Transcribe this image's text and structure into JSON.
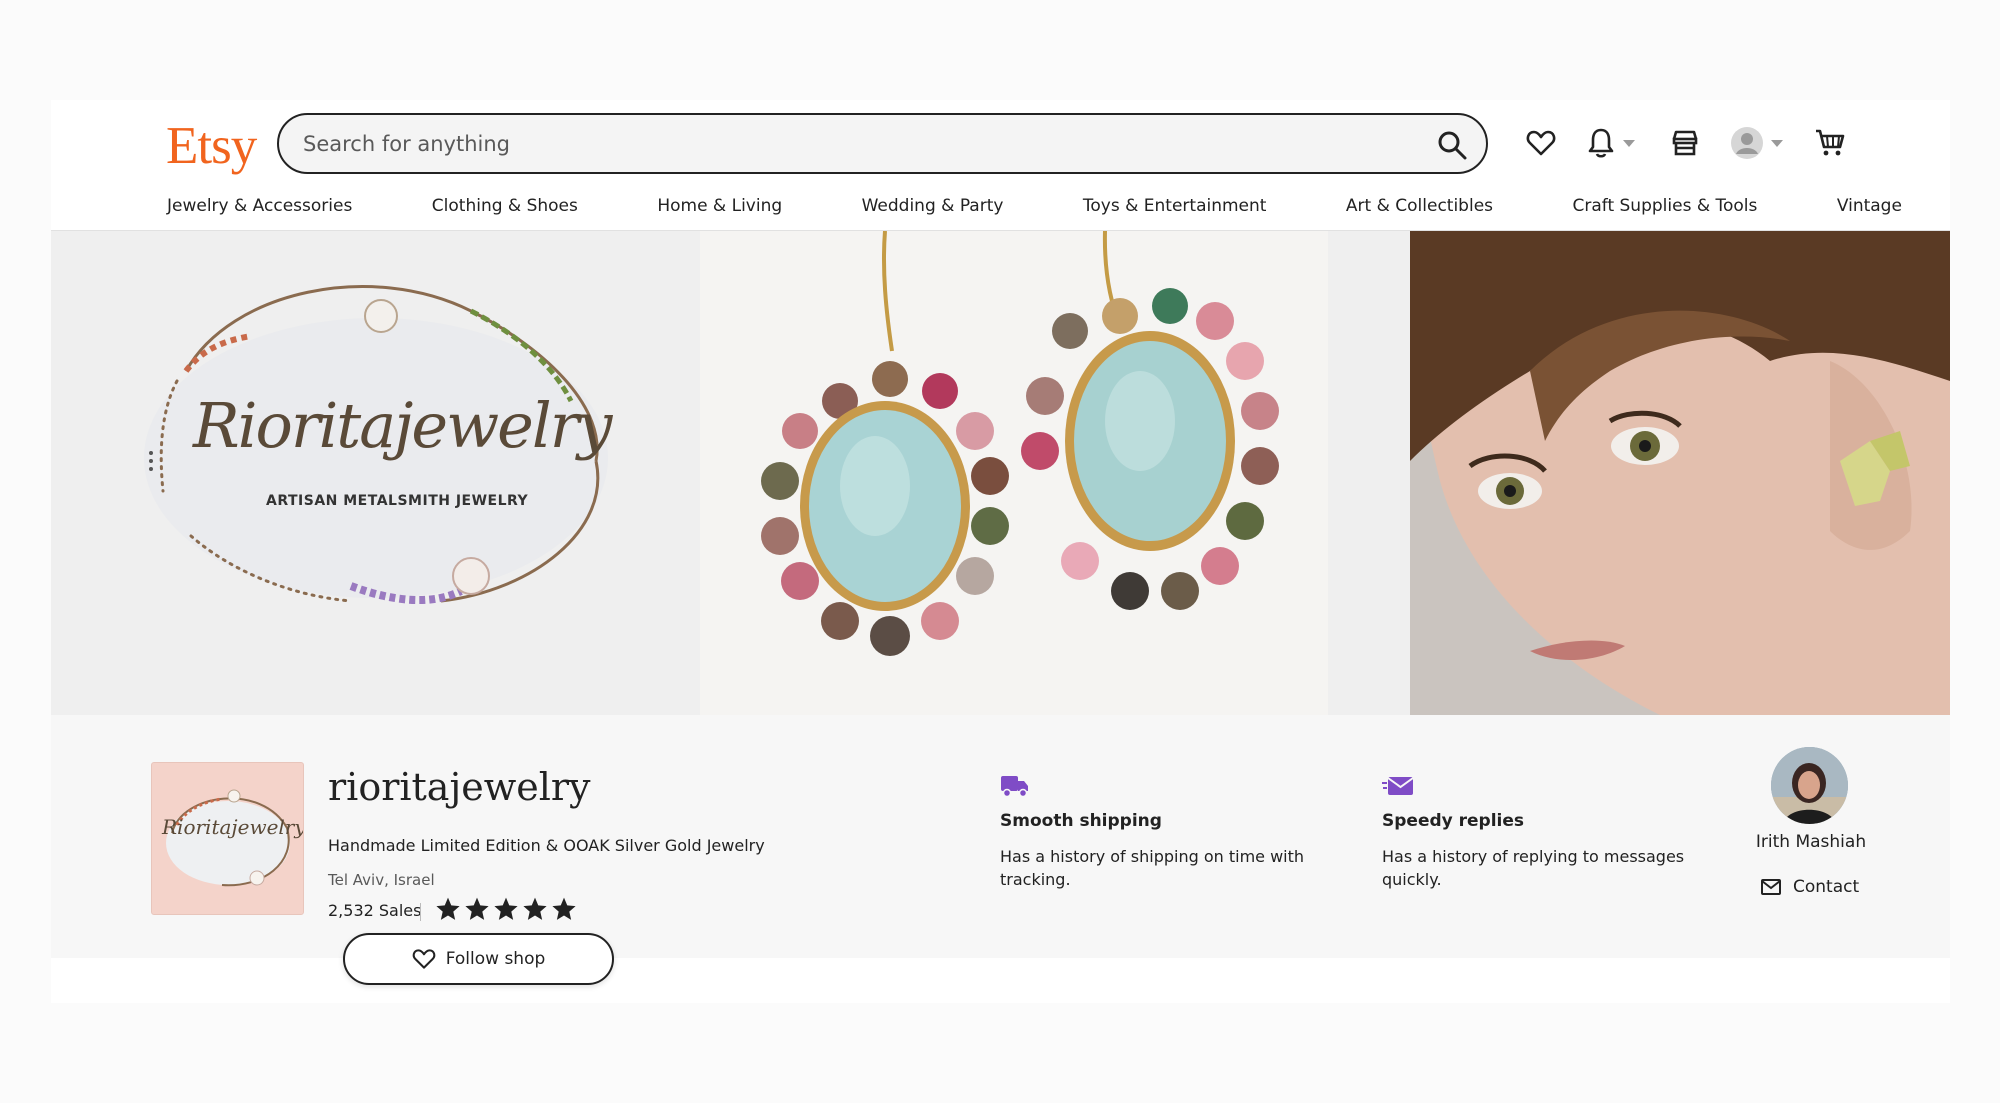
{
  "header": {
    "logo": "Etsy",
    "search_placeholder": "Search for anything"
  },
  "nav": {
    "items": [
      "Jewelry & Accessories",
      "Clothing & Shoes",
      "Home & Living",
      "Wedding & Party",
      "Toys & Entertainment",
      "Art & Collectibles",
      "Craft Supplies & Tools",
      "Vintage"
    ]
  },
  "banner": {
    "art_title": "Rioritajewelry",
    "art_subtitle": "ARTISAN METALSMITH JEWELRY"
  },
  "shop": {
    "avatar_text": "Rioritajewelry",
    "name": "rioritajewelry",
    "tagline": "Handmade Limited Edition & OOAK Silver Gold Jewelry",
    "location": "Tel Aviv, Israel",
    "sales": "2,532 Sales",
    "rating": 5,
    "follow_label": "Follow shop"
  },
  "features": [
    {
      "title": "Smooth shipping",
      "desc": "Has a history of shipping on time with tracking."
    },
    {
      "title": "Speedy replies",
      "desc": "Has a history of replying to messages quickly."
    }
  ],
  "owner": {
    "name": "Irith Mashiah",
    "contact_label": "Contact"
  },
  "colors": {
    "brand": "#f1641e",
    "feature_icon": "#7f4cc6"
  }
}
